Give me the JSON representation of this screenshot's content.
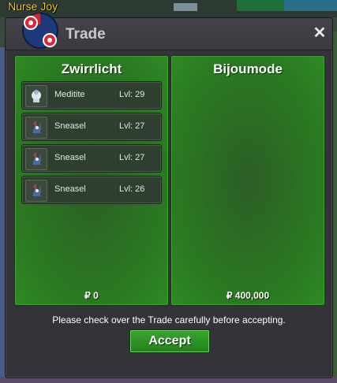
{
  "overlay": {
    "player_name": "Nurse Joy"
  },
  "window": {
    "title": "Trade",
    "close_glyph": "✕"
  },
  "left_panel": {
    "owner": "Zwirrlicht",
    "items": [
      {
        "name": "Meditite",
        "level": "Lvl: 29",
        "icon": "meditite-sprite-icon"
      },
      {
        "name": "Sneasel",
        "level": "Lvl: 27",
        "icon": "sneasel-sprite-icon"
      },
      {
        "name": "Sneasel",
        "level": "Lvl: 27",
        "icon": "sneasel-sprite-icon"
      },
      {
        "name": "Sneasel",
        "level": "Lvl: 26",
        "icon": "sneasel-sprite-icon"
      }
    ],
    "money": "₽ 0"
  },
  "right_panel": {
    "owner": "Bijoumode",
    "items": [],
    "money": "₽ 400,000"
  },
  "notice": "Please check over the Trade carefully before accepting.",
  "accept_label": "Accept",
  "colors": {
    "panel_green": "#2a7a21",
    "accept_green": "#2f9426",
    "title_text": "#c9c9cf",
    "player_name": "#f2d21e"
  }
}
